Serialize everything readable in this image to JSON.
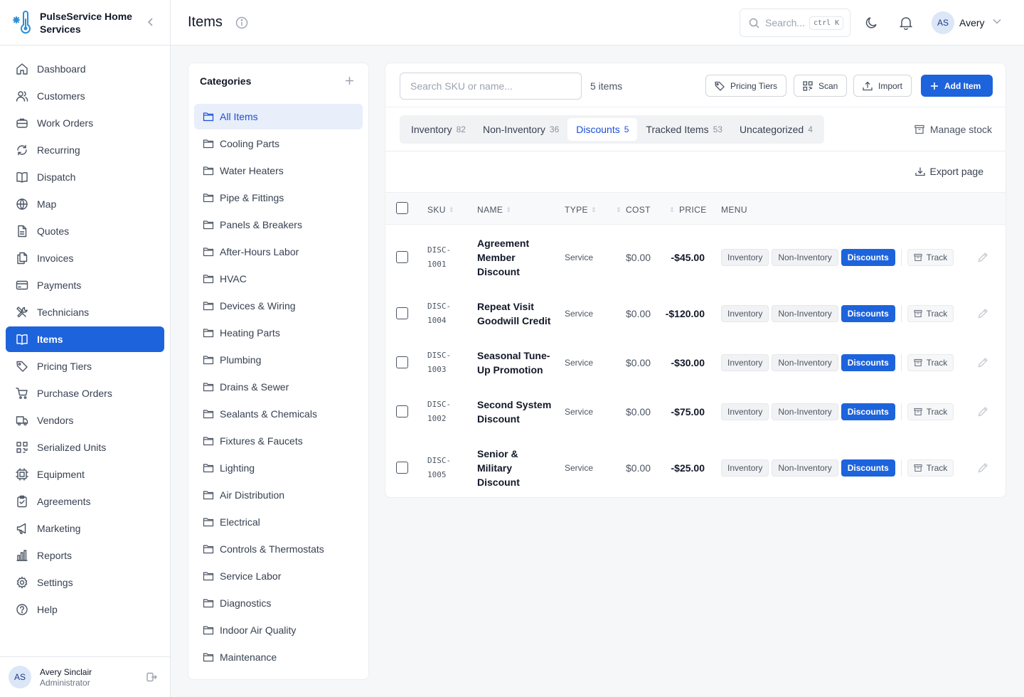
{
  "brand": {
    "name": "PulseService Home Services"
  },
  "nav": [
    {
      "label": "Dashboard",
      "icon": "home-icon"
    },
    {
      "label": "Customers",
      "icon": "users-icon"
    },
    {
      "label": "Work Orders",
      "icon": "briefcase-icon"
    },
    {
      "label": "Recurring",
      "icon": "refresh-icon"
    },
    {
      "label": "Dispatch",
      "icon": "book-open-icon"
    },
    {
      "label": "Map",
      "icon": "globe-icon"
    },
    {
      "label": "Quotes",
      "icon": "file-icon"
    },
    {
      "label": "Invoices",
      "icon": "files-icon"
    },
    {
      "label": "Payments",
      "icon": "credit-card-icon"
    },
    {
      "label": "Technicians",
      "icon": "tools-icon"
    },
    {
      "label": "Items",
      "icon": "book-open-icon",
      "active": true
    },
    {
      "label": "Pricing Tiers",
      "icon": "tag-icon"
    },
    {
      "label": "Purchase Orders",
      "icon": "cart-icon"
    },
    {
      "label": "Vendors",
      "icon": "truck-icon"
    },
    {
      "label": "Serialized Units",
      "icon": "qr-icon"
    },
    {
      "label": "Equipment",
      "icon": "chip-icon"
    },
    {
      "label": "Agreements",
      "icon": "clipboard-icon"
    },
    {
      "label": "Marketing",
      "icon": "megaphone-icon"
    },
    {
      "label": "Reports",
      "icon": "bar-chart-icon"
    },
    {
      "label": "Settings",
      "icon": "gear-icon"
    },
    {
      "label": "Help",
      "icon": "help-icon"
    }
  ],
  "user": {
    "initials": "AS",
    "name": "Avery Sinclair",
    "role": "Administrator",
    "first_name": "Avery"
  },
  "header": {
    "title": "Items",
    "search_placeholder": "Search...",
    "shortcut": "ctrl K"
  },
  "categories": {
    "title": "Categories",
    "items": [
      {
        "label": "All Items",
        "active": true
      },
      {
        "label": "Cooling Parts"
      },
      {
        "label": "Water Heaters"
      },
      {
        "label": "Pipe & Fittings"
      },
      {
        "label": "Panels & Breakers"
      },
      {
        "label": "After-Hours Labor"
      },
      {
        "label": "HVAC"
      },
      {
        "label": "Devices & Wiring"
      },
      {
        "label": "Heating Parts"
      },
      {
        "label": "Plumbing"
      },
      {
        "label": "Drains & Sewer"
      },
      {
        "label": "Sealants & Chemicals"
      },
      {
        "label": "Fixtures & Faucets"
      },
      {
        "label": "Lighting"
      },
      {
        "label": "Air Distribution"
      },
      {
        "label": "Electrical"
      },
      {
        "label": "Controls & Thermostats"
      },
      {
        "label": "Service Labor"
      },
      {
        "label": "Diagnostics"
      },
      {
        "label": "Indoor Air Quality"
      },
      {
        "label": "Maintenance"
      }
    ]
  },
  "toolbar": {
    "search_placeholder": "Search SKU or name...",
    "count": "5 items",
    "pricing_tiers": "Pricing Tiers",
    "scan": "Scan",
    "import": "Import",
    "add_item": "Add Item"
  },
  "tabs": [
    {
      "label": "Inventory",
      "count": "82"
    },
    {
      "label": "Non-Inventory",
      "count": "36"
    },
    {
      "label": "Discounts",
      "count": "5",
      "active": true
    },
    {
      "label": "Tracked Items",
      "count": "53"
    },
    {
      "label": "Uncategorized",
      "count": "4"
    }
  ],
  "manage_stock": "Manage stock",
  "export_page": "Export page",
  "table": {
    "columns": {
      "sku": "SKU",
      "name": "NAME",
      "type": "TYPE",
      "cost": "COST",
      "price": "PRICE",
      "menu": "MENU"
    },
    "chips": {
      "inventory": "Inventory",
      "non_inventory": "Non-Inventory",
      "discounts": "Discounts",
      "track": "Track"
    },
    "rows": [
      {
        "sku": "DISC-1001",
        "name": "Agreement Member Discount",
        "type": "Service",
        "cost": "$0.00",
        "price": "-$45.00"
      },
      {
        "sku": "DISC-1004",
        "name": "Repeat Visit Goodwill Credit",
        "type": "Service",
        "cost": "$0.00",
        "price": "-$120.00"
      },
      {
        "sku": "DISC-1003",
        "name": "Seasonal Tune-Up Promotion",
        "type": "Service",
        "cost": "$0.00",
        "price": "-$30.00"
      },
      {
        "sku": "DISC-1002",
        "name": "Second System Discount",
        "type": "Service",
        "cost": "$0.00",
        "price": "-$75.00"
      },
      {
        "sku": "DISC-1005",
        "name": "Senior & Military Discount",
        "type": "Service",
        "cost": "$0.00",
        "price": "-$25.00"
      }
    ]
  },
  "colors": {
    "accent": "#1d63dc",
    "active_bg": "#e8effa"
  }
}
